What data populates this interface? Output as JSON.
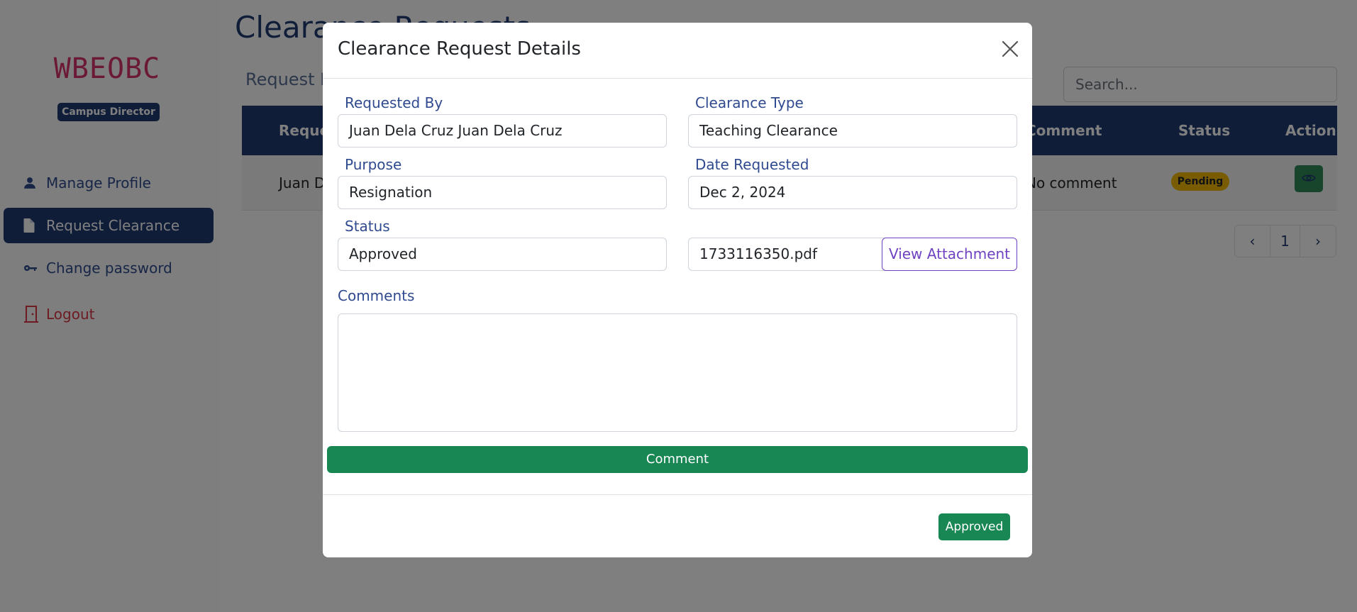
{
  "sidebar": {
    "brand": "WBEOBC",
    "role_badge": "Campus Director",
    "items": [
      {
        "label": "Manage Profile",
        "icon": "user-icon"
      },
      {
        "label": "Request Clearance",
        "icon": "document-icon"
      },
      {
        "label": "Change password",
        "icon": "key-icon"
      },
      {
        "label": "Logout",
        "icon": "door-icon"
      }
    ]
  },
  "page": {
    "title": "Clearance Requests",
    "card_subtitle": "Request List",
    "search_placeholder": "Search...",
    "table": {
      "headers": [
        "Requested By",
        "Comment",
        "Status",
        "Action"
      ],
      "rows": [
        {
          "requested_by": "Juan Dela Cruz",
          "comment": "No comment",
          "status": "Pending"
        }
      ]
    },
    "pagination": {
      "prev": "‹",
      "current": "1",
      "next": "›"
    }
  },
  "modal": {
    "title": "Clearance Request Details",
    "fields": {
      "requested_by": {
        "label": "Requested By",
        "value": "Juan Dela Cruz Juan Dela Cruz"
      },
      "clearance_type": {
        "label": "Clearance Type",
        "value": "Teaching Clearance"
      },
      "purpose": {
        "label": "Purpose",
        "value": "Resignation"
      },
      "date_requested": {
        "label": "Date Requested",
        "value": "Dec 2, 2024"
      },
      "status": {
        "label": "Status",
        "value": "Approved"
      },
      "attachment": {
        "value": "1733116350.pdf",
        "button_label": "View Attachment"
      }
    },
    "comments_label": "Comments",
    "comments_value": "",
    "comment_button": "Comment",
    "footer_status_button": "Approved"
  },
  "colors": {
    "primary": "#1f3b73",
    "brand": "#d6336c",
    "success": "#198754",
    "warning": "#f2b705",
    "danger": "#dc3545",
    "attachment_outline": "#6f42c1"
  }
}
